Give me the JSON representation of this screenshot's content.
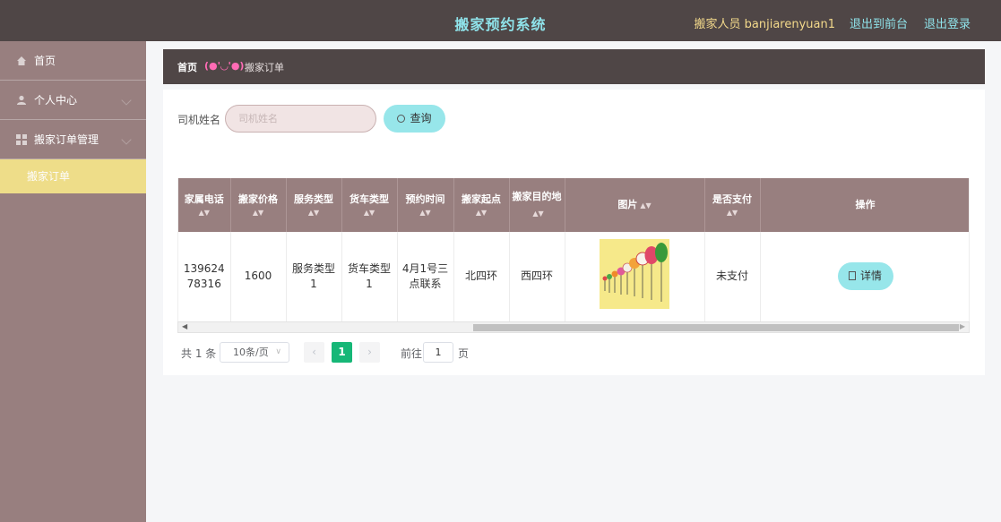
{
  "header": {
    "title": "搬家预约系统",
    "user_label": "搬家人员 banjiarenyuan1",
    "front_link": "退出到前台",
    "logout_link": "退出登录"
  },
  "sidebar": {
    "items": [
      {
        "label": "首页",
        "icon": "home-icon"
      },
      {
        "label": "个人中心",
        "icon": "user-icon"
      },
      {
        "label": "搬家订单管理",
        "icon": "grid-icon"
      }
    ],
    "sub_item": "搬家订单"
  },
  "breadcrumb": {
    "home": "首页",
    "face": "(●'◡'●)",
    "current": "搬家订单"
  },
  "search": {
    "label": "司机姓名",
    "placeholder": "司机姓名",
    "button_label": "查询"
  },
  "table": {
    "headers": [
      "家属电话",
      "搬家价格",
      "服务类型",
      "货车类型",
      "预约时间",
      "搬家起点",
      "搬家目的地",
      "图片",
      "是否支付",
      "操作"
    ],
    "row": {
      "phone": "13962478316",
      "price": "1600",
      "service_type": "服务类型1",
      "truck_type": "货车类型1",
      "time": "4月1号三点联系",
      "start": "北四环",
      "dest": "西四环",
      "paid": "未支付",
      "action": "详情"
    }
  },
  "pagination": {
    "total": "共 1 条",
    "page_size": "10条/页",
    "current_page": "1",
    "goto_label": "前往",
    "goto_value": "1",
    "page_suffix": "页"
  },
  "colors": {
    "topbar": "#4f4646",
    "sidebar": "#987f7f",
    "accent_cyan": "#97e6ea",
    "active_item": "#f0df8a",
    "pager_active": "#16b777"
  }
}
